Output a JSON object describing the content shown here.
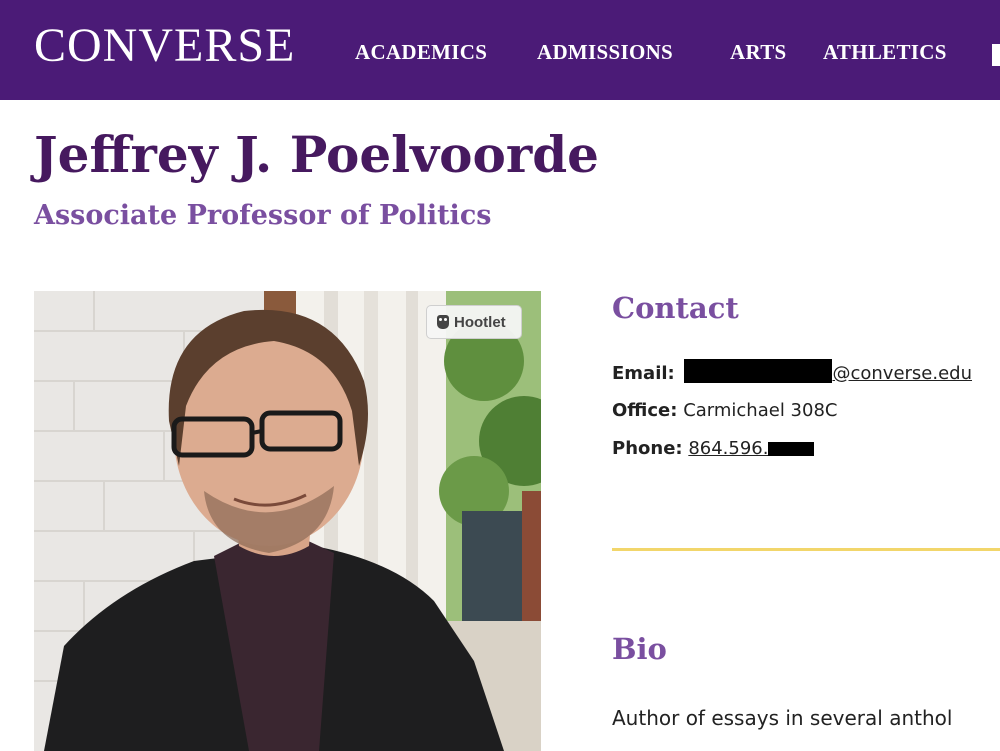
{
  "header": {
    "logo": "CONVERSE",
    "nav": [
      {
        "label": "ACADEMICS"
      },
      {
        "label": "ADMISSIONS"
      },
      {
        "label": "ARTS"
      },
      {
        "label": "ATHLETICS"
      }
    ]
  },
  "profile": {
    "name": "Jeffrey J. Poelvoorde",
    "title": "Associate Professor of Politics",
    "photo_badge": "Hootlet"
  },
  "contact": {
    "heading": "Contact",
    "email_label": "Email:",
    "email_domain": "@converse.edu",
    "office_label": "Office:",
    "office_value": "Carmichael 308C",
    "phone_label": "Phone:",
    "phone_prefix": "864.596."
  },
  "bio": {
    "heading": "Bio",
    "text": "Author of essays in several anthol"
  },
  "colors": {
    "header_bg": "#4b1b77",
    "name": "#46195f",
    "accent": "#7a4fa0",
    "divider": "#f2d66b"
  }
}
